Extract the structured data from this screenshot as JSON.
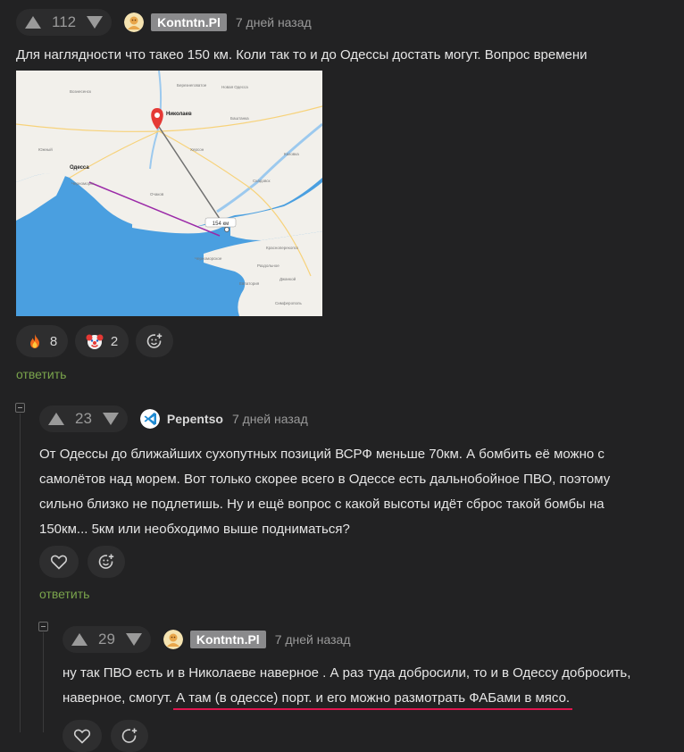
{
  "comment1": {
    "score": "112",
    "username": "Kontntn.Pl",
    "time": "7 дней назад",
    "text": "Для наглядности что такео 150 км. Коли так то и до Одессы достать могут. Вопрос времени",
    "map": {
      "city_label": "Николаев",
      "city2_label": "Одесса",
      "distance_label": "154 км",
      "places": [
        "Березнеговатое",
        "Вознесенск",
        "Новая Одесса",
        "Баштанка",
        "Снигирёвка",
        "Херсон",
        "Каховка",
        "Скадовск",
        "Черноморск",
        "Южный",
        "Очаков",
        "Новая Каховка",
        "Каланчак",
        "Красноперекопск",
        "Джанкой",
        "Симферополь",
        "Евпатория",
        "Черноморское",
        "Раздольное"
      ]
    },
    "reactions": [
      {
        "icon": "fire-emoji",
        "count": "8"
      },
      {
        "icon": "clown-emoji",
        "count": "2"
      }
    ],
    "reply_label": "ответить"
  },
  "comment2": {
    "score": "23",
    "username": "Pepentso",
    "time": "7 дней назад",
    "text_lines": [
      "От Одессы до ближайших сухопутных позиций ВСРФ меньше 70км. А бомбить её можно с",
      "самолётов над морем. Вот только скорее всего в Одессе есть дальнобойное ПВО, поэтому",
      "сильно близко не подлетишь. Ну и ещё вопрос с какой высоты идёт сброс такой бомбы на",
      "150км... 5км или необходимо выше подниматься?"
    ],
    "reply_label": "ответить"
  },
  "comment3": {
    "score": "29",
    "username": "Kontntn.Pl",
    "time": "7 дней назад",
    "line1": "ну так ПВО есть и в Николаеве наверное . А раз туда добросили, то и в Одессу добросить,",
    "line2_a": "наверное, смогут. ",
    "line2_b": "А там (в одессе) порт. и его можно размотрать ФАБами в мясо.",
    "underline_color": "#e0164f"
  },
  "colors": {
    "background": "#222223",
    "reply_green": "#7aa44c",
    "badge_gray": "#8a8a8c",
    "sea": "#4a9fe0",
    "land": "#f2f0eb"
  }
}
